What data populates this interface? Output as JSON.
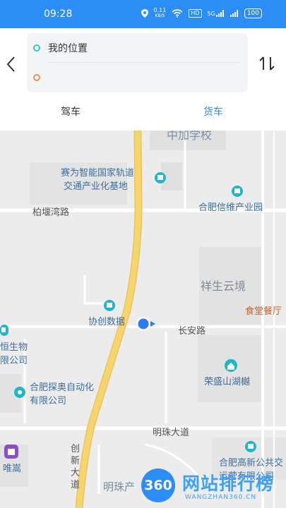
{
  "status_bar": {
    "time": "09:28",
    "speed_value": "0.11",
    "speed_unit": "KB/S",
    "hd_label": "HD",
    "network_label": "5G",
    "battery": "100"
  },
  "route_panel": {
    "start_value": "我的位置",
    "end_placeholder": ""
  },
  "tabs": [
    {
      "label": "驾车",
      "active": false
    },
    {
      "label": "货车",
      "active": true
    }
  ],
  "map": {
    "labels": {
      "school": "中加学校",
      "rail_line1": "赛为智能国家轨道",
      "rail_line2": "交通产业化基地",
      "xinwei": "合肥信维产业园",
      "baiyan_road": "柏堰湾路",
      "xiangsheng": "祥生云境",
      "canteen": "食堂餐厅",
      "xiechuang": "协创数据",
      "changan_road": "长安路",
      "hengsheng1": "恒生物",
      "hengsheng2": "限公司",
      "tanao1": "合肥探奥自动化",
      "tanao2": "有限公司",
      "rongsheng": "荣盛山湖樾",
      "mingzhu_road": "明珠大道",
      "chuangxin": "创新大道",
      "weisong": "唯嵩",
      "gaoxin1": "合肥高新公共交",
      "gaoxin2": "运营有限公司",
      "mingzhu_bottom": "明珠产"
    },
    "colors": {
      "main_road": "#f7d56e",
      "bus_icon": "#1fb6c5",
      "canteen_text": "#c7612b",
      "poi_text": "#3d6f9e",
      "road_text": "#555555"
    }
  },
  "watermark": {
    "circle_text": "360",
    "title": "网站排行榜",
    "url": "WANGZHAN360.CN"
  }
}
